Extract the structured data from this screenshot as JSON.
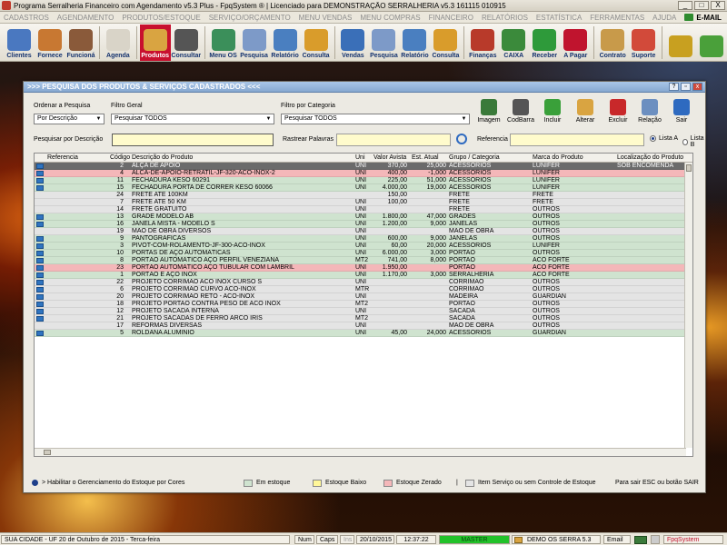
{
  "window": {
    "title": "Programa Serralheria Financeiro com Agendamento v5.3 Plus - FpqSystem ® | Licenciado para  DEMONSTRAÇÃO SERRALHERIA v5.3 161115 010915",
    "min": "_",
    "max": "□",
    "close": "X"
  },
  "menu": [
    "CADASTROS",
    "AGENDAMENTO",
    "PRODUTOS/ESTOQUE",
    "SERVIÇO/ORÇAMENTO",
    "MENU VENDAS",
    "MENU COMPRAS",
    "FINANCEIRO",
    "RELATÓRIOS",
    "ESTATÍSTICA",
    "FERRAMENTAS",
    "AJUDA"
  ],
  "menu_email": "E-MAIL",
  "toolbar": [
    {
      "label": "Clientes",
      "icon": "clients-icon",
      "color": "#4a78c0"
    },
    {
      "label": "Fornece",
      "icon": "suppliers-icon",
      "color": "#c87832"
    },
    {
      "label": "Funcioná",
      "icon": "employees-icon",
      "color": "#8a5a3a"
    },
    {
      "label": "Agenda",
      "icon": "calendar-icon",
      "color": "#d9d4c8"
    },
    {
      "label": "Produtos",
      "icon": "products-icon",
      "color": "#d9a441"
    },
    {
      "label": "Consultar",
      "icon": "barcode-icon",
      "color": "#555555"
    },
    {
      "label": "Menu OS",
      "icon": "service-order-icon",
      "color": "#3b8f5a"
    },
    {
      "label": "Pesquisa",
      "icon": "search-docs-icon",
      "color": "#7d9ac8"
    },
    {
      "label": "Relatório",
      "icon": "report-icon",
      "color": "#4a7fc0"
    },
    {
      "label": "Consulta",
      "icon": "folder-icon",
      "color": "#d99c2b"
    },
    {
      "label": "Vendas",
      "icon": "monitor-icon",
      "color": "#3a6fb8"
    },
    {
      "label": "Pesquisa",
      "icon": "search-docs-icon",
      "color": "#7d9ac8"
    },
    {
      "label": "Relatório",
      "icon": "report-icon",
      "color": "#4a7fc0"
    },
    {
      "label": "Consulta",
      "icon": "folder-icon",
      "color": "#d99c2b"
    },
    {
      "label": "Finanças",
      "icon": "finance-icon",
      "color": "#b83a2a"
    },
    {
      "label": "CAIXA",
      "icon": "cash-icon",
      "color": "#3b8a3b"
    },
    {
      "label": "Receber",
      "icon": "receive-money-icon",
      "color": "#2e9a3a"
    },
    {
      "label": "A Pagar",
      "icon": "pay-money-icon",
      "color": "#c0142e"
    },
    {
      "label": "Contrato",
      "icon": "contract-icon",
      "color": "#c89a4a"
    },
    {
      "label": "Suporte",
      "icon": "support-icon",
      "color": "#d24a3a"
    },
    {
      "label": "",
      "icon": "coins-icon",
      "color": "#c8a020"
    },
    {
      "label": "",
      "icon": "exit-icon",
      "color": "#4aa03a"
    }
  ],
  "dialog": {
    "title": ">>>  PESQUISA DOS PRODUTOS & SERVIÇOS CADASTRADOS  <<<",
    "help": "?",
    "restore": "▫",
    "close": "x",
    "order_label": "Ordenar a Pesquisa",
    "order_value": "Por Descrição",
    "general_filter_label": "Filtro Geral",
    "general_filter_value": "Pesquisar TODOS",
    "category_filter_label": "Filtro por Categoria",
    "category_filter_value": "Pesquisar TODOS",
    "search_desc_label": "Pesquisar por Descrição",
    "search_desc_value": "",
    "track_label": "Rastrear Palavras",
    "track_value": "",
    "ref_label": "Referencia",
    "ref_value": "",
    "list_a": "Lista A",
    "list_b": "Lista B",
    "actions": [
      {
        "label": "Imagem",
        "icon": "image-icon",
        "color": "#3a7a3a"
      },
      {
        "label": "CodBarra",
        "icon": "barcode-icon",
        "color": "#555555"
      },
      {
        "label": "Incluir",
        "icon": "add-icon",
        "color": "#3aa03a"
      },
      {
        "label": "Alterar",
        "icon": "edit-icon",
        "color": "#d9a441"
      },
      {
        "label": "Excluir",
        "icon": "delete-icon",
        "color": "#c8282a"
      },
      {
        "label": "Relação",
        "icon": "print-icon",
        "color": "#6c8fc0"
      },
      {
        "label": "Sair",
        "icon": "exit-arrow-icon",
        "color": "#2e6ac0"
      }
    ]
  },
  "grid": {
    "columns": [
      "Referencia",
      "Código",
      "Descrição do Produto",
      "Uni",
      "Valor Avista",
      "Est. Atual",
      "Grupo / Categoria",
      "Marca do Produto",
      "Localização do Produto"
    ],
    "rows": [
      {
        "icon": true,
        "style": "sel",
        "code": "2",
        "desc": "ALÇA DE APOIO",
        "uni": "UNI",
        "price": "370,00",
        "stock": "25,000",
        "group": "ACESSORIOS",
        "brand": "LUNIFER",
        "loc": "SOB ENCOMENDA"
      },
      {
        "icon": true,
        "style": "pink",
        "code": "4",
        "desc": "ALCA-DE-APOIO-RETRATIL-JF-320-ACO-INOX-2",
        "uni": "UNI",
        "price": "400,00",
        "stock": "-1,000",
        "group": "ACESSORIOS",
        "brand": "LUNIFER",
        "loc": ""
      },
      {
        "icon": true,
        "style": "green",
        "code": "11",
        "desc": "FECHADURA KESO 60291",
        "uni": "UNI",
        "price": "225,00",
        "stock": "51,000",
        "group": "ACESSORIOS",
        "brand": "LUNIFER",
        "loc": ""
      },
      {
        "icon": true,
        "style": "green",
        "code": "15",
        "desc": "FECHADURA PORTA DE CORRER KESO 60066",
        "uni": "UNI",
        "price": "4.000,00",
        "stock": "19,000",
        "group": "ACESSORIOS",
        "brand": "LUNIFER",
        "loc": ""
      },
      {
        "icon": false,
        "style": "grey",
        "code": "24",
        "desc": "FRETE ATÉ 100KM",
        "uni": "",
        "price": "150,00",
        "stock": "",
        "group": "FRETE",
        "brand": "FRETE",
        "loc": ""
      },
      {
        "icon": false,
        "style": "grey",
        "code": "7",
        "desc": "FRETE ATÉ 50 KM",
        "uni": "UNI",
        "price": "100,00",
        "stock": "",
        "group": "FRETE",
        "brand": "FRETE",
        "loc": ""
      },
      {
        "icon": false,
        "style": "grey",
        "code": "14",
        "desc": "FRETE GRATUITO",
        "uni": "UNI",
        "price": "",
        "stock": "",
        "group": "FRETE",
        "brand": "OUTROS",
        "loc": ""
      },
      {
        "icon": true,
        "style": "green",
        "code": "13",
        "desc": "GRADE MODELO AB",
        "uni": "UNI",
        "price": "1.800,00",
        "stock": "47,000",
        "group": "GRADES",
        "brand": "OUTROS",
        "loc": ""
      },
      {
        "icon": true,
        "style": "green",
        "code": "16",
        "desc": "JANELA MISTA - MODELO S",
        "uni": "UNI",
        "price": "1.200,00",
        "stock": "9,000",
        "group": "JANELAS",
        "brand": "OUTROS",
        "loc": ""
      },
      {
        "icon": false,
        "style": "grey",
        "code": "19",
        "desc": "MAO DE OBRA DIVERSOS",
        "uni": "UNI",
        "price": "",
        "stock": "",
        "group": "MAO DE OBRA",
        "brand": "OUTROS",
        "loc": ""
      },
      {
        "icon": true,
        "style": "green",
        "code": "9",
        "desc": "PANTOGRÁFICAS",
        "uni": "UNI",
        "price": "600,00",
        "stock": "9,000",
        "group": "JANELAS",
        "brand": "OUTROS",
        "loc": ""
      },
      {
        "icon": true,
        "style": "green",
        "code": "3",
        "desc": "PIVOT-COM-ROLAMENTO-JF-300-ACO-INOX",
        "uni": "UNI",
        "price": "60,00",
        "stock": "20,000",
        "group": "ACESSORIOS",
        "brand": "LUNIFER",
        "loc": ""
      },
      {
        "icon": true,
        "style": "green",
        "code": "10",
        "desc": "PORTAS DE AÇO AUTOMÁTICAS",
        "uni": "UNI",
        "price": "6.000,00",
        "stock": "3,000",
        "group": "PORTAO",
        "brand": "OUTROS",
        "loc": ""
      },
      {
        "icon": true,
        "style": "green",
        "code": "8",
        "desc": "PORTÃO AUTOMÁTICO AÇO PERFIL VENEZIANA",
        "uni": "MT2",
        "price": "741,00",
        "stock": "8,000",
        "group": "PORTAO",
        "brand": "ACO FORTE",
        "loc": ""
      },
      {
        "icon": true,
        "style": "pink",
        "code": "23",
        "desc": "PORTÃO AUTOMÁTICO AÇO TUBULAR COM LAMBRIL",
        "uni": "UNI",
        "price": "1.950,00",
        "stock": "",
        "group": "PORTAO",
        "brand": "ACO FORTE",
        "loc": ""
      },
      {
        "icon": true,
        "style": "green",
        "code": "1",
        "desc": "PORTÃO E AÇO INOX",
        "uni": "UNI",
        "price": "1.170,00",
        "stock": "3,000",
        "group": "SERRALHERIA",
        "brand": "ACO FORTE",
        "loc": ""
      },
      {
        "icon": true,
        "style": "grey",
        "code": "22",
        "desc": "PROJETO CORRIMAO ACO INOX CURSO S",
        "uni": "UNI",
        "price": "",
        "stock": "",
        "group": "CORRIMAO",
        "brand": "OUTROS",
        "loc": ""
      },
      {
        "icon": true,
        "style": "grey",
        "code": "6",
        "desc": "PROJETO CORRIMAO CURVO ACO-INOX",
        "uni": "MTR",
        "price": "",
        "stock": "",
        "group": "CORRIMAO",
        "brand": "OUTROS",
        "loc": ""
      },
      {
        "icon": true,
        "style": "grey",
        "code": "20",
        "desc": "PROJETO CORRIMAO RETO - ACO-INOX",
        "uni": "UNI",
        "price": "",
        "stock": "",
        "group": "MADEIRA",
        "brand": "GUARDIAN",
        "loc": ""
      },
      {
        "icon": true,
        "style": "grey",
        "code": "18",
        "desc": "PROJETO PORTAO CONTRA PESO DE ACO INOX",
        "uni": "MT2",
        "price": "",
        "stock": "",
        "group": "PORTAO",
        "brand": "OUTROS",
        "loc": ""
      },
      {
        "icon": true,
        "style": "grey",
        "code": "12",
        "desc": "PROJETO SACADA INTERNA",
        "uni": "UNI",
        "price": "",
        "stock": "",
        "group": "SACADA",
        "brand": "OUTROS",
        "loc": ""
      },
      {
        "icon": true,
        "style": "grey",
        "code": "21",
        "desc": "PROJETO SACADAS DE FERRO ARCO IRIS",
        "uni": "MT2",
        "price": "",
        "stock": "",
        "group": "SACADA",
        "brand": "OUTROS",
        "loc": ""
      },
      {
        "icon": false,
        "style": "grey",
        "code": "17",
        "desc": "REFORMAS DIVERSAS",
        "uni": "UNI",
        "price": "",
        "stock": "",
        "group": "MAO DE OBRA",
        "brand": "OUTROS",
        "loc": ""
      },
      {
        "icon": true,
        "style": "green",
        "code": "5",
        "desc": "ROLDANA ALUMINIO",
        "uni": "UNI",
        "price": "45,00",
        "stock": "24,000",
        "group": "ACESSORIOS",
        "brand": "GUARDIAN",
        "loc": ""
      }
    ]
  },
  "legend": {
    "enable_text": "> Habilitar o Gerenciamento do Estoque por Cores",
    "in_stock": "Em estoque",
    "low_stock": "Estoque Baixo",
    "zero_stock": "Estoque Zerado",
    "separator": "|",
    "service_item": "Item Serviço ou sem Controle de Estoque",
    "exit_hint": "Para sair ESC ou botão SAIR",
    "colors": {
      "in_stock": "#cfe3cf",
      "low_stock": "#fff799",
      "zero_stock": "#f4b7b9",
      "service_item": "#e4e4e4"
    }
  },
  "statusbar": {
    "city": "SUA CIDADE - UF 20 de Outubro de 2015 - Terca-feira",
    "num": "Num",
    "caps": "Caps",
    "ins": "Ins",
    "date": "20/10/2015",
    "time": "12:37:22",
    "master": "MASTER",
    "demo": "DEMO OS SERRA 5.3",
    "email": "Email",
    "brand": "FpqSystem"
  }
}
